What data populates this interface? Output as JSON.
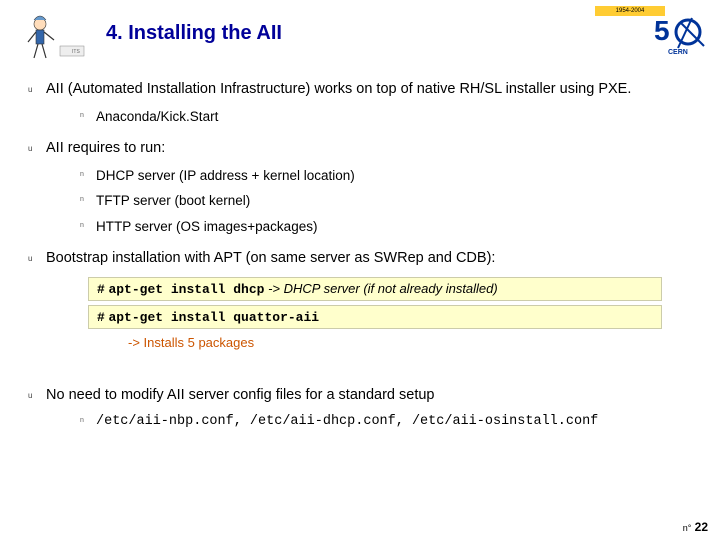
{
  "header": {
    "title": "4. Installing the AII",
    "top_strip": "1954-2004",
    "logo50": "5"
  },
  "bullets": {
    "b1": "AII (Automated Installation Infrastructure) works on top of native RH/SL installer using PXE.",
    "b1_s1": "Anaconda/Kick.Start",
    "b2": "AII requires to run:",
    "b2_s1": "DHCP server (IP address + kernel location)",
    "b2_s2": "TFTP server (boot kernel)",
    "b2_s3": "HTTP server (OS images+packages)",
    "b3": "Bootstrap installation with APT (on same server as SWRep and CDB):",
    "b4": "No need to modify AII server config files for a standard setup",
    "b4_s1": "/etc/aii-nbp.conf, /etc/aii-dhcp.conf, /etc/aii-osinstall.conf"
  },
  "codebox": {
    "line1_hash": "#",
    "line1_cmd": "apt-get install dhcp",
    "line1_note": "-> DHCP server (if not already installed)",
    "line2_hash": "#",
    "line2_cmd": "apt-get install quattor-aii"
  },
  "installs_note": "-> Installs 5 packages",
  "footer": {
    "page_prefix": "n°",
    "page_num": "22"
  }
}
